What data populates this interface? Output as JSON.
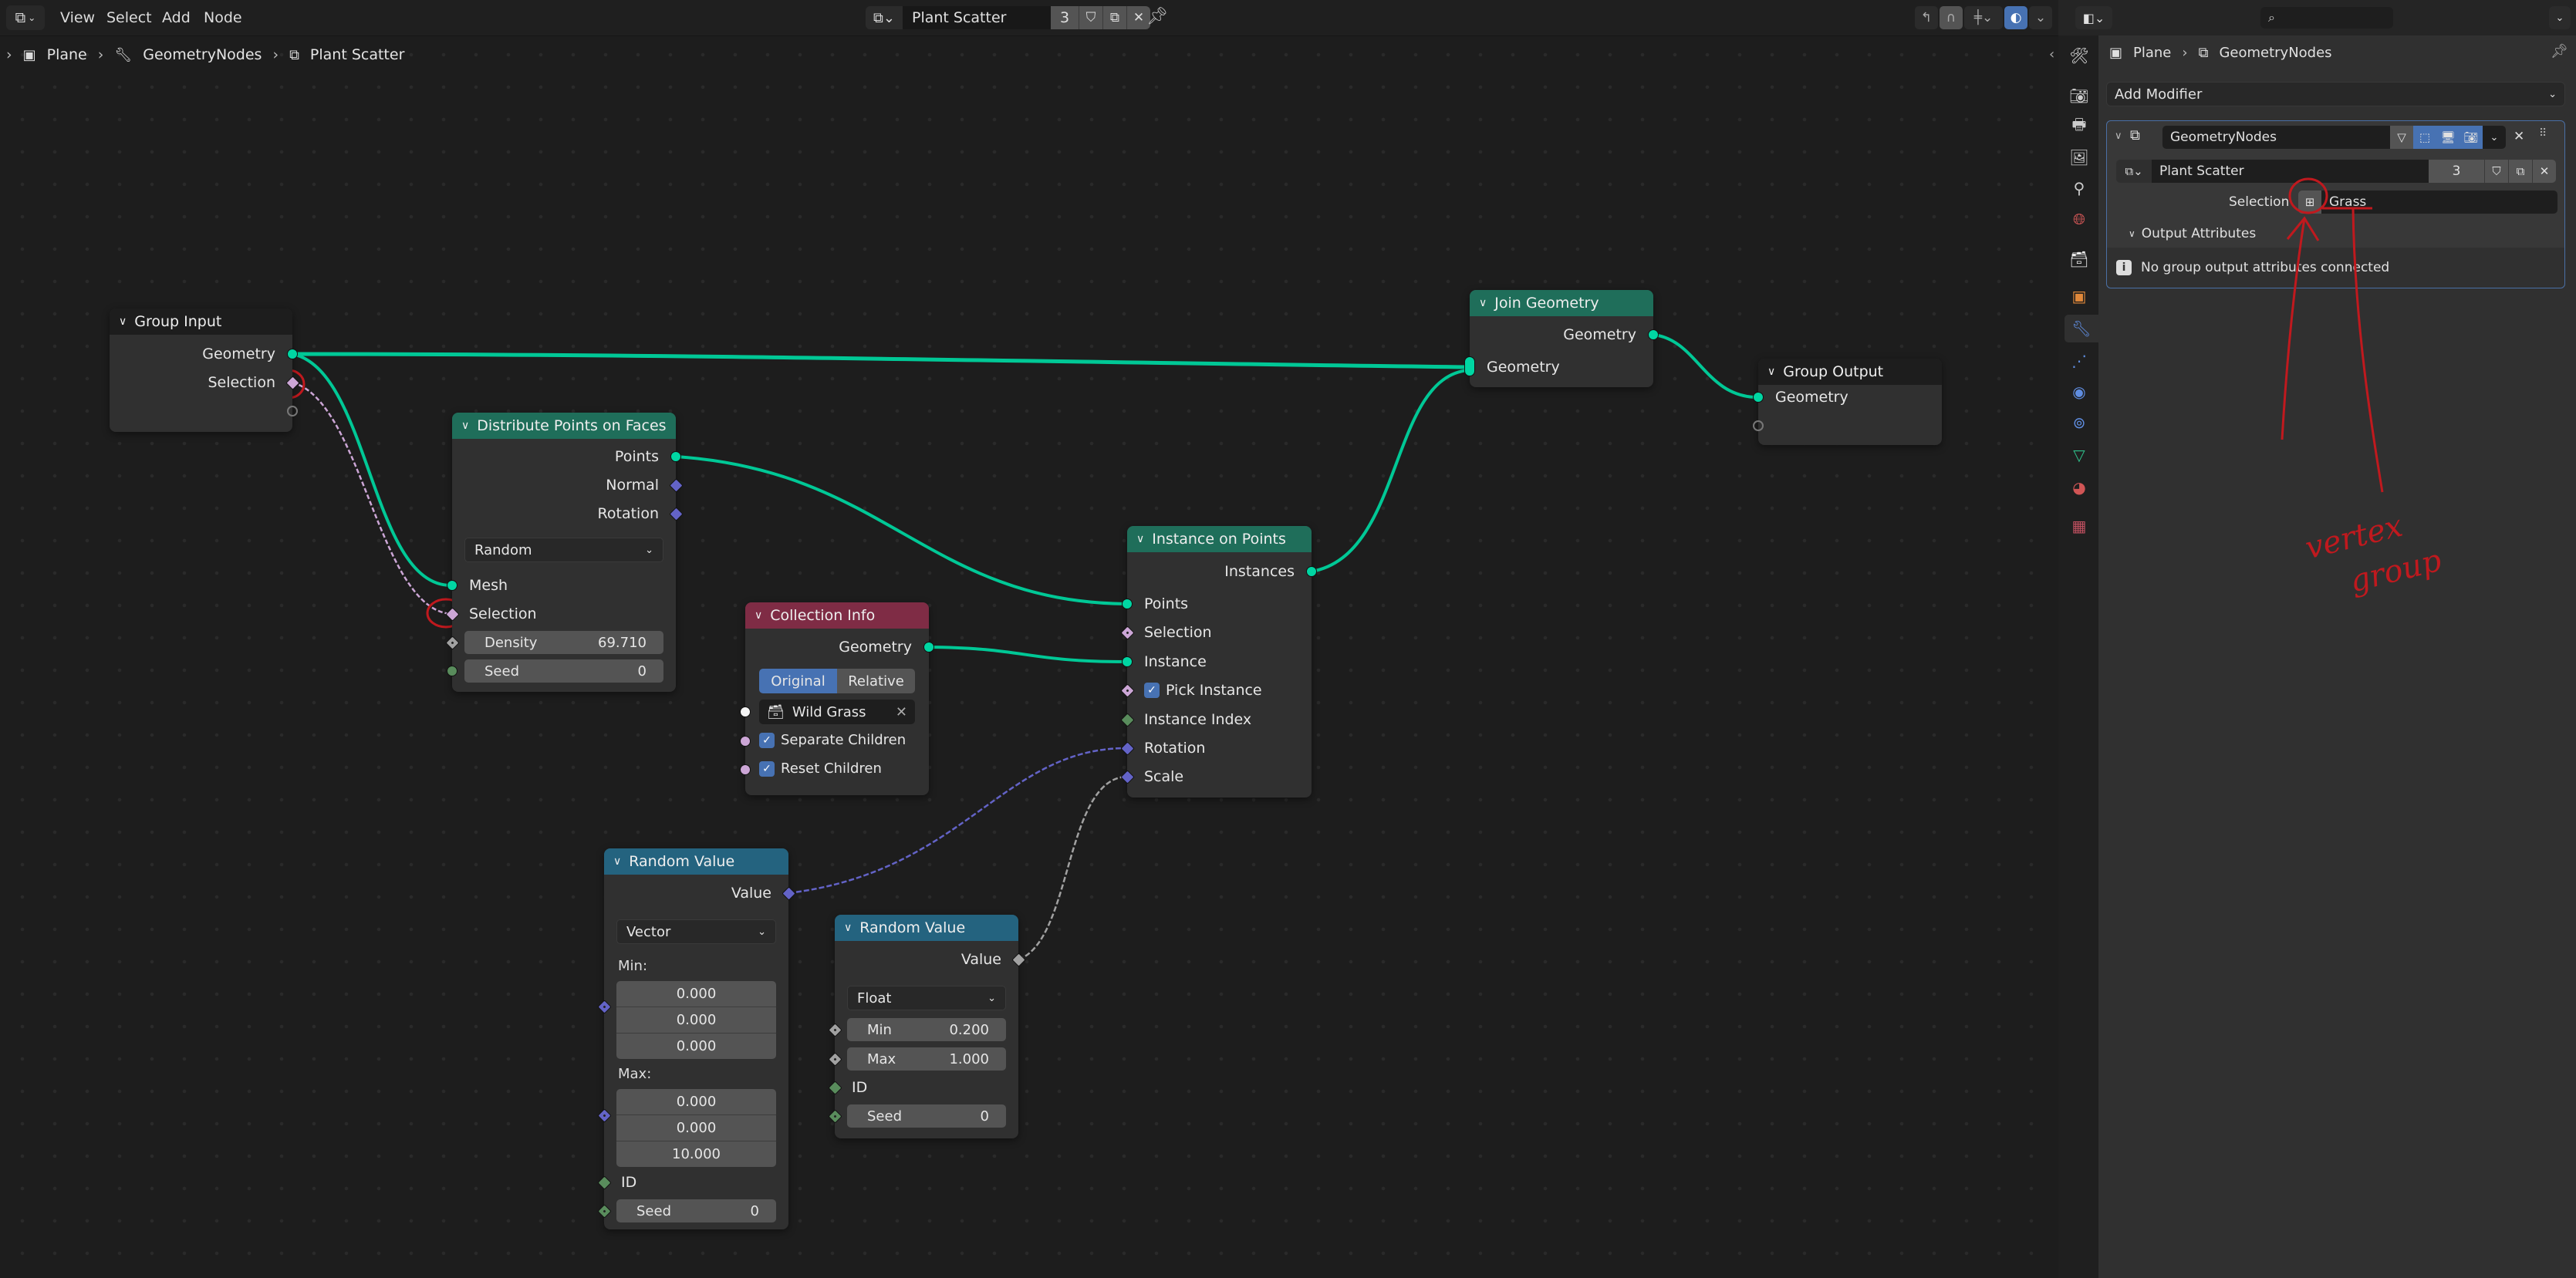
{
  "editor": {
    "menus": [
      "View",
      "Select",
      "Add",
      "Node"
    ],
    "node_group": {
      "name": "Plant Scatter",
      "users": "3"
    },
    "breadcrumb": [
      "Plane",
      "GeometryNodes",
      "Plant Scatter"
    ]
  },
  "nodes": {
    "group_input": {
      "title": "Group Input",
      "outputs": [
        "Geometry",
        "Selection"
      ]
    },
    "distribute": {
      "title": "Distribute Points on Faces",
      "outputs": [
        "Points",
        "Normal",
        "Rotation"
      ],
      "mode": "Random",
      "inputs": [
        "Mesh",
        "Selection"
      ],
      "density_label": "Density",
      "density": "69.710",
      "seed_label": "Seed",
      "seed": "0"
    },
    "collection_info": {
      "title": "Collection Info",
      "output": "Geometry",
      "transform_options": [
        "Original",
        "Relative"
      ],
      "selected_transform": "Original",
      "collection": "Wild Grass",
      "separate_children": "Separate Children",
      "reset_children": "Reset Children"
    },
    "instance_on_points": {
      "title": "Instance on Points",
      "output": "Instances",
      "inputs": [
        "Points",
        "Selection",
        "Instance",
        "Pick Instance",
        "Instance Index",
        "Rotation",
        "Scale"
      ]
    },
    "join_geometry": {
      "title": "Join Geometry",
      "output": "Geometry",
      "input": "Geometry"
    },
    "group_output": {
      "title": "Group Output",
      "input": "Geometry"
    },
    "random_vector": {
      "title": "Random Value",
      "output": "Value",
      "type": "Vector",
      "min_label": "Min:",
      "min": [
        "0.000",
        "0.000",
        "0.000"
      ],
      "max_label": "Max:",
      "max": [
        "0.000",
        "0.000",
        "10.000"
      ],
      "id_label": "ID",
      "seed_label": "Seed",
      "seed": "0"
    },
    "random_float": {
      "title": "Random Value",
      "output": "Value",
      "type": "Float",
      "min_label": "Min",
      "min": "0.200",
      "max_label": "Max",
      "max": "1.000",
      "id_label": "ID",
      "seed_label": "Seed",
      "seed": "0"
    }
  },
  "properties": {
    "breadcrumb": [
      "Plane",
      "GeometryNodes"
    ],
    "add_modifier": "Add Modifier",
    "modifier": {
      "name": "GeometryNodes",
      "node_group": "Plant Scatter",
      "users": "3",
      "selection_label": "Selection",
      "selection_value": "Grass",
      "output_attributes": "Output Attributes",
      "info": "No group output attributes connected"
    }
  },
  "annotation": {
    "text_line1": "vertex",
    "text_line2": "group",
    "color": "#c0191e"
  },
  "colors": {
    "geometry_socket": "#00d6a3",
    "vector_socket": "#6363c7",
    "bool_socket": "#cca6d6",
    "accent": "#4772b3"
  }
}
